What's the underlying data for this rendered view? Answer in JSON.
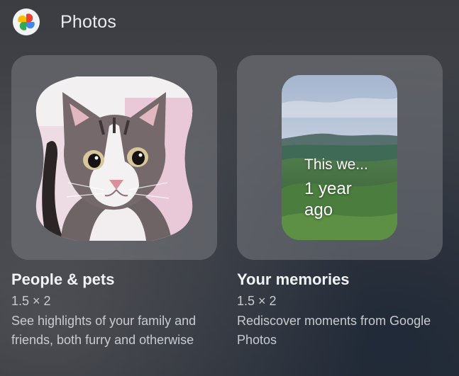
{
  "header": {
    "title": "Photos",
    "icon": "google-photos-pinwheel-icon"
  },
  "widgets": [
    {
      "title": "People & pets",
      "size": "1.5 × 2",
      "description": "See highlights of your family and friends, both furry and otherwise",
      "preview": "cat-photo"
    },
    {
      "title": "Your memories",
      "size": "1.5 × 2",
      "description": "Rediscover moments from Google Photos",
      "preview": "landscape-photo",
      "overlay": {
        "line1": "This we...",
        "line2": "1 year",
        "line3": "ago"
      }
    }
  ],
  "colors": {
    "accent_red": "#ea4335",
    "accent_blue": "#4285f4",
    "accent_yellow": "#fbbc04",
    "accent_green": "#34a853"
  }
}
